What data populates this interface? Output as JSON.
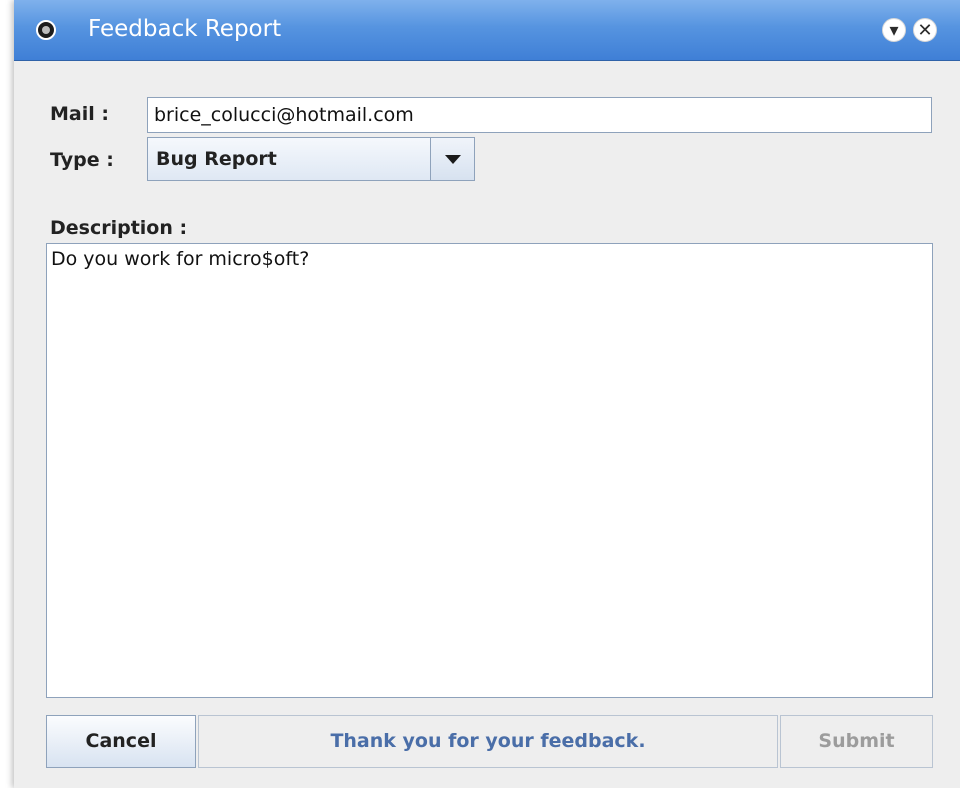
{
  "window": {
    "title": "Feedback Report",
    "icons": {
      "app": "app-menu-icon",
      "minimize": "shade-down-icon",
      "close": "close-icon"
    }
  },
  "form": {
    "mail_label": "Mail :",
    "mail_value": "brice_colucci@hotmail.com",
    "type_label": "Type :",
    "type_value": "Bug Report",
    "description_label": "Description :",
    "description_value": "Do you work for micro$oft?"
  },
  "footer": {
    "cancel_label": "Cancel",
    "status_text": "Thank you for your feedback.",
    "submit_label": "Submit",
    "submit_enabled": false
  },
  "colors": {
    "titlebar": "#5694e0",
    "status_text": "#4a6ea8",
    "disabled_text": "#9c9c9c"
  }
}
